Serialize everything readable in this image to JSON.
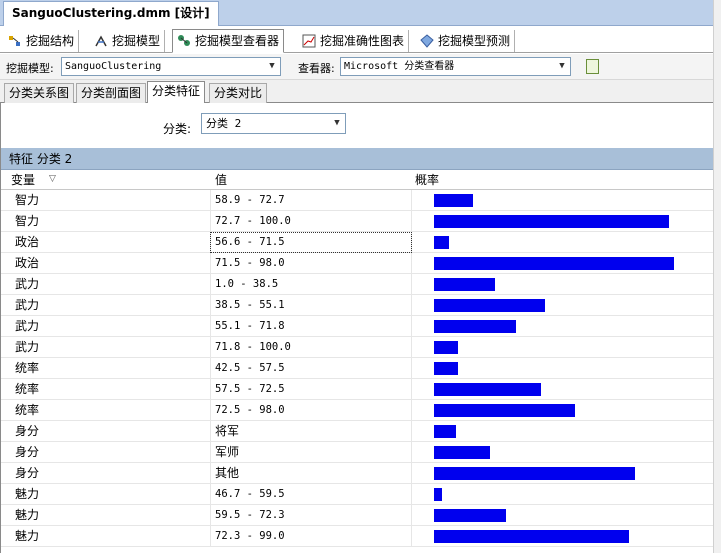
{
  "document_tab": {
    "title": "SanguoClustering.dmm [设计]"
  },
  "designer_tabs": [
    {
      "label": "挖掘结构",
      "icon": "mining-structure-icon"
    },
    {
      "label": "挖掘模型",
      "icon": "mining-model-icon"
    },
    {
      "label": "挖掘模型查看器",
      "icon": "model-viewer-icon",
      "active": true
    },
    {
      "label": "挖掘准确性图表",
      "icon": "accuracy-chart-icon"
    },
    {
      "label": "挖掘模型预测",
      "icon": "prediction-icon"
    }
  ],
  "toolbar": {
    "model_label": "挖掘模型:",
    "model_value": "SanguoClustering",
    "viewer_label": "查看器:",
    "viewer_value": "Microsoft 分类查看器"
  },
  "viewer_tabs": [
    {
      "label": "分类关系图"
    },
    {
      "label": "分类剖面图"
    },
    {
      "label": "分类特征",
      "active": true
    },
    {
      "label": "分类对比"
    }
  ],
  "cluster_selector": {
    "label": "分类:",
    "value": "分类 2"
  },
  "grid": {
    "title": "特征 分类 2",
    "columns": {
      "variable": "变量",
      "value": "值",
      "probability": "概率"
    },
    "rows": [
      {
        "variable": "智力",
        "value": "58.9 - 72.7",
        "probability": 0.161
      },
      {
        "variable": "智力",
        "value": "72.7 - 100.0",
        "probability": 0.978
      },
      {
        "variable": "政治",
        "value": "56.6 - 71.5",
        "probability": 0.064,
        "focused": true
      },
      {
        "variable": "政治",
        "value": "71.5 - 98.0",
        "probability": 1.0
      },
      {
        "variable": "武力",
        "value": "1.0 - 38.5",
        "probability": 0.256
      },
      {
        "variable": "武力",
        "value": "38.5 - 55.1",
        "probability": 0.461
      },
      {
        "variable": "武力",
        "value": "55.1 - 71.8",
        "probability": 0.342
      },
      {
        "variable": "武力",
        "value": "71.8 - 100.0",
        "probability": 0.1
      },
      {
        "variable": "统率",
        "value": "42.5 - 57.5",
        "probability": 0.1
      },
      {
        "variable": "统率",
        "value": "57.5 - 72.5",
        "probability": 0.447
      },
      {
        "variable": "统率",
        "value": "72.5 - 98.0",
        "probability": 0.589
      },
      {
        "variable": "身分",
        "value": "将军",
        "probability": 0.091
      },
      {
        "variable": "身分",
        "value": "军师",
        "probability": 0.233
      },
      {
        "variable": "身分",
        "value": "其他",
        "probability": 0.836
      },
      {
        "variable": "魅力",
        "value": "46.7 - 59.5",
        "probability": 0.032
      },
      {
        "variable": "魅力",
        "value": "59.5 - 72.3",
        "probability": 0.301
      },
      {
        "variable": "魅力",
        "value": "72.3 - 99.0",
        "probability": 0.813
      }
    ]
  },
  "colors": {
    "bar": "#0000ee",
    "grid_header": "#a8bfd8"
  }
}
